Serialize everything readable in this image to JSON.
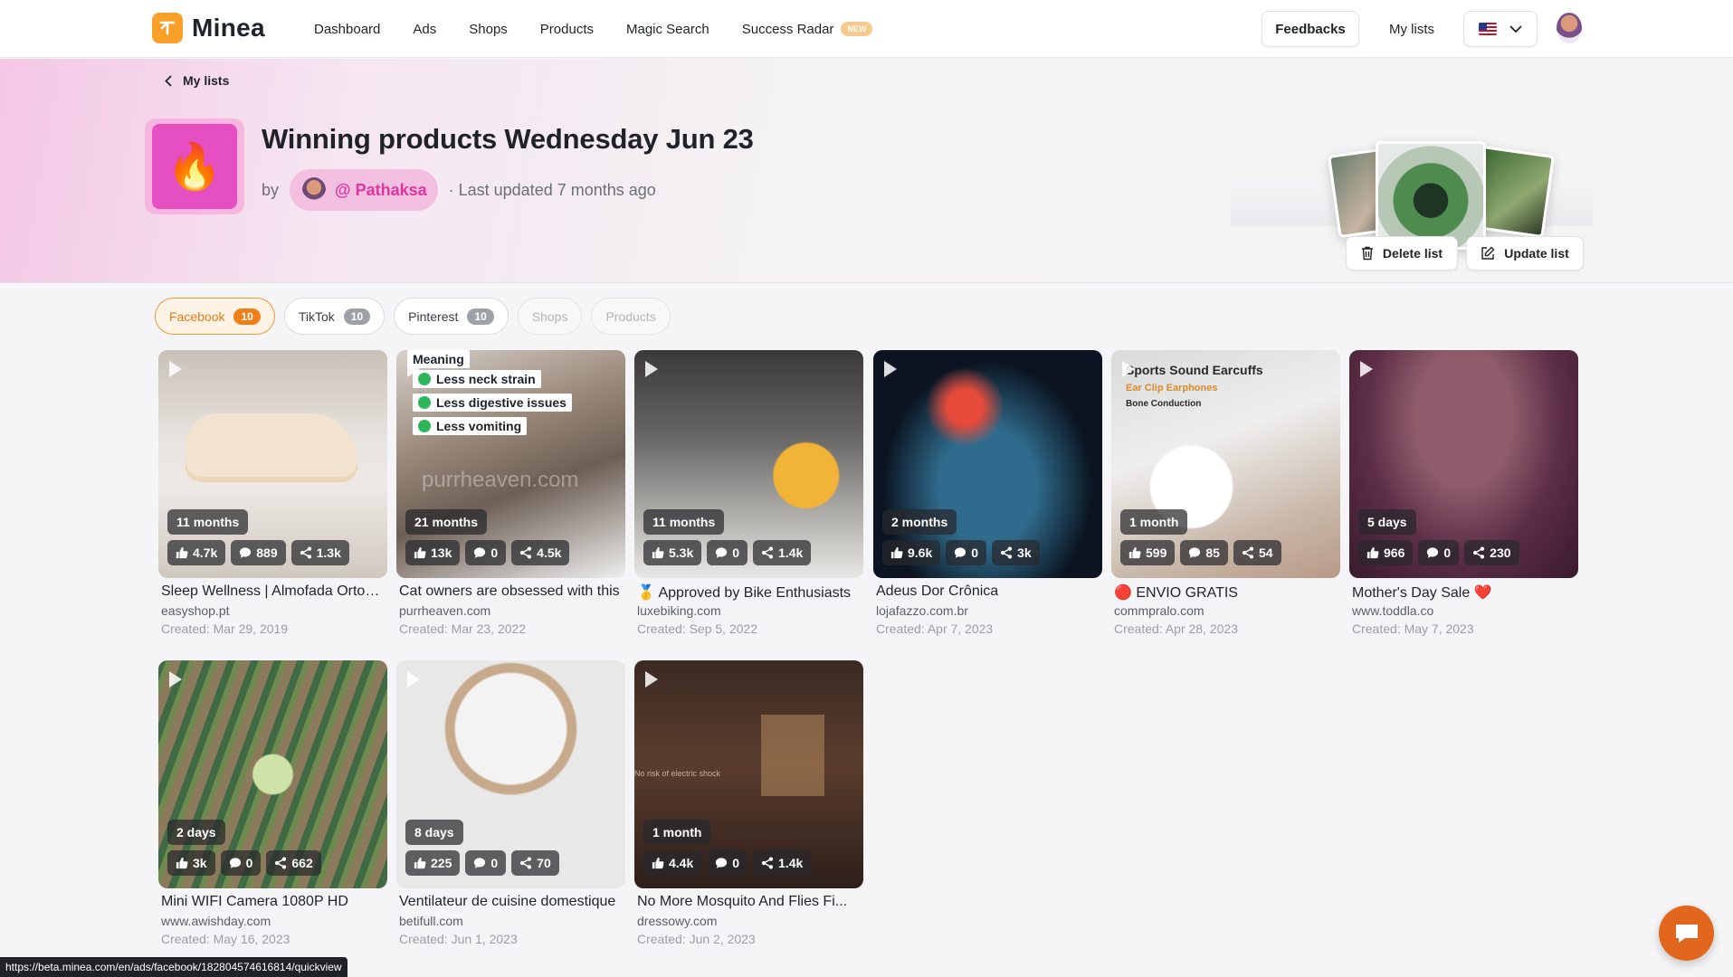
{
  "app": {
    "logo_text": "Minea"
  },
  "nav": {
    "links": [
      "Dashboard",
      "Ads",
      "Shops",
      "Products",
      "Magic Search",
      "Success Radar"
    ],
    "new_badge": "NEW",
    "feedbacks": "Feedbacks",
    "my_lists": "My lists"
  },
  "header": {
    "back_label": "My lists",
    "title": "Winning products Wednesday Jun 23",
    "by": "by",
    "author": "@ Pathaksa",
    "updated": "· Last updated 7 months ago",
    "delete_label": "Delete list",
    "update_label": "Update list"
  },
  "tabs": [
    {
      "label": "Facebook",
      "count": "10"
    },
    {
      "label": "TikTok",
      "count": "10"
    },
    {
      "label": "Pinterest",
      "count": "10"
    },
    {
      "label": "Shops"
    },
    {
      "label": "Products"
    }
  ],
  "cards": [
    {
      "age": "11 months",
      "likes": "4.7k",
      "comments": "889",
      "shares": "1.3k",
      "title": "Sleep Wellness | Almofada Ortopédica",
      "domain": "easyshop.pt",
      "created": "Created: Mar 29, 2019"
    },
    {
      "age": "21 months",
      "likes": "13k",
      "comments": "0",
      "shares": "4.5k",
      "title": "Cat owners are obsessed with this",
      "domain": "purrheaven.com",
      "created": "Created: Mar 23, 2022",
      "overlay": {
        "heading": "Meaning",
        "items": [
          "Less neck strain",
          "Less digestive issues",
          "Less vomiting"
        ],
        "watermark": "purrheaven.com"
      }
    },
    {
      "age": "11 months",
      "likes": "5.3k",
      "comments": "0",
      "shares": "1.4k",
      "title": "🥇 Approved by Bike Enthusiasts",
      "domain": "luxebiking.com",
      "created": "Created: Sep 5, 2022"
    },
    {
      "age": "2 months",
      "likes": "9.6k",
      "comments": "0",
      "shares": "3k",
      "title": "Adeus Dor Crônica",
      "domain": "lojafazzo.com.br",
      "created": "Created: Apr 7, 2023"
    },
    {
      "age": "1 month",
      "likes": "599",
      "comments": "85",
      "shares": "54",
      "title": "🔴 ENVIO GRATIS",
      "domain": "commpralo.com",
      "created": "Created: Apr 28, 2023",
      "overlay": {
        "heading": "Sports Sound Earcuffs",
        "sub1": "Ear Clip Earphones",
        "sub2": "Bone Conduction"
      }
    },
    {
      "age": "5 days",
      "likes": "966",
      "comments": "0",
      "shares": "230",
      "title": "Mother's Day Sale ❤️",
      "domain": "www.toddla.co",
      "created": "Created: May 7, 2023"
    },
    {
      "age": "2 days",
      "likes": "3k",
      "comments": "0",
      "shares": "662",
      "title": "Mini WIFI Camera 1080P HD",
      "domain": "www.awishday.com",
      "created": "Created: May 16, 2023"
    },
    {
      "age": "8 days",
      "likes": "225",
      "comments": "0",
      "shares": "70",
      "title": "Ventilateur de cuisine domestique",
      "domain": "betifull.com",
      "created": "Created: Jun 1, 2023"
    },
    {
      "age": "1 month",
      "likes": "4.4k",
      "comments": "0",
      "shares": "1.4k",
      "title": "No More Mosquito And Flies Fi...",
      "domain": "dressowy.com",
      "created": "Created: Jun 2, 2023",
      "overlay": {
        "caption": "No risk of electric shock"
      }
    }
  ],
  "status_url": "https://beta.minea.com/en/ads/facebook/182804574616814/quickview",
  "colors": {
    "accent": "#f07f1a",
    "pink": "#e64fc2",
    "chat": "#e2671e"
  }
}
